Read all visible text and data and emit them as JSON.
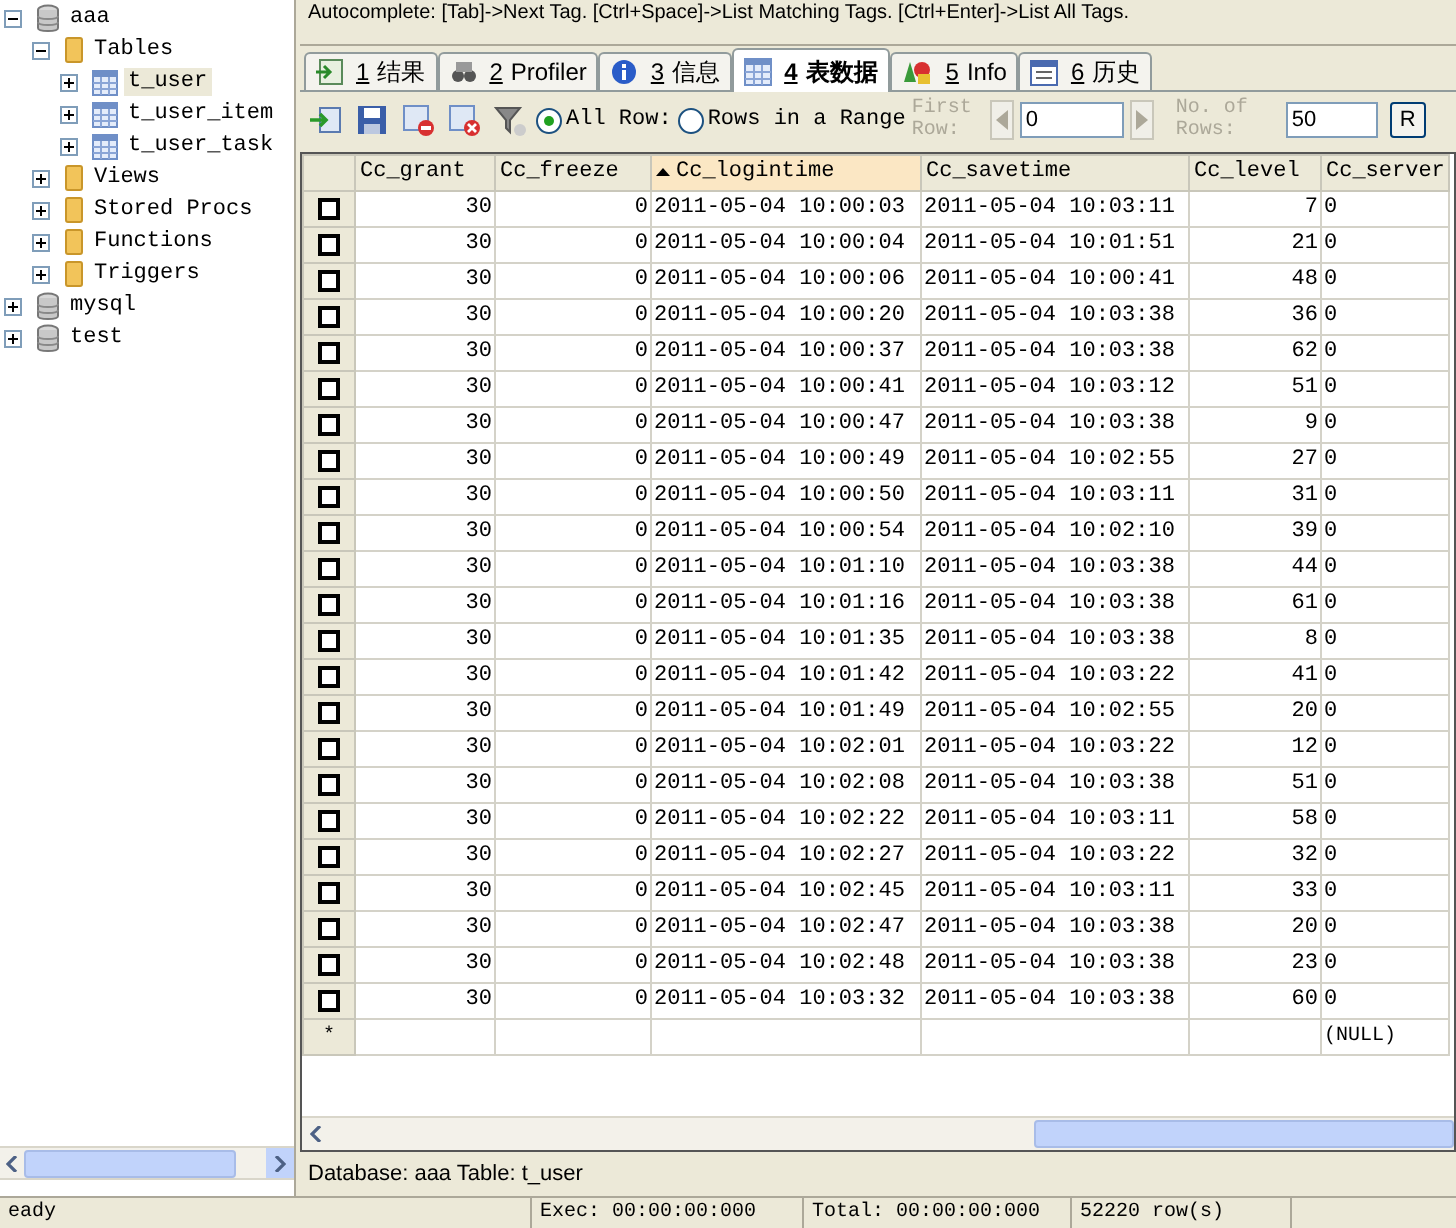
{
  "tree": [
    {
      "label": "aaa",
      "kind": "database",
      "expanded": true,
      "selected": false,
      "children": [
        {
          "label": "Tables",
          "kind": "folder",
          "expanded": true,
          "selected": false,
          "children": [
            {
              "label": "t_user",
              "kind": "table",
              "expanded": false,
              "selected": true
            },
            {
              "label": "t_user_item",
              "kind": "table",
              "expanded": false,
              "selected": false
            },
            {
              "label": "t_user_task",
              "kind": "table",
              "expanded": false,
              "selected": false
            }
          ]
        },
        {
          "label": "Views",
          "kind": "folder",
          "expanded": false,
          "selected": false
        },
        {
          "label": "Stored Procs",
          "kind": "folder",
          "expanded": false,
          "selected": false
        },
        {
          "label": "Functions",
          "kind": "folder",
          "expanded": false,
          "selected": false
        },
        {
          "label": "Triggers",
          "kind": "folder",
          "expanded": false,
          "selected": false
        }
      ]
    },
    {
      "label": "mysql",
      "kind": "database",
      "expanded": false,
      "selected": false
    },
    {
      "label": "test",
      "kind": "database",
      "expanded": false,
      "selected": false
    }
  ],
  "autocomplete_hint": "Autocomplete: [Tab]->Next Tag. [Ctrl+Space]->List Matching Tags. [Ctrl+Enter]->List All Tags.",
  "tabs": [
    {
      "number": "1",
      "label": "结果",
      "kind": "result",
      "selected": false
    },
    {
      "number": "2",
      "label": "Profiler",
      "kind": "profiler",
      "selected": false
    },
    {
      "number": "3",
      "label": "信息",
      "kind": "info",
      "selected": false
    },
    {
      "number": "4",
      "label": "表数据",
      "kind": "table",
      "selected": true
    },
    {
      "number": "5",
      "label": "Info",
      "kind": "shapes",
      "selected": false
    },
    {
      "number": "6",
      "label": "历史",
      "kind": "calendar",
      "selected": false
    }
  ],
  "toolbar": {
    "radios": [
      {
        "label": "All Row:",
        "selected": true
      },
      {
        "label": "Rows in a Range",
        "selected": false
      }
    ],
    "range": {
      "disabled": true,
      "first_row_label": "First Row:",
      "first_row_value": "0",
      "rows_label": "No. of Rows:",
      "rows_value": "50"
    },
    "refresh_button": "R"
  },
  "table": {
    "columns": [
      {
        "label": "Cc_grant",
        "sorted_ascending": false
      },
      {
        "label": "Cc_freeze",
        "sorted_ascending": false
      },
      {
        "label": "Cc_logintime",
        "sorted_ascending": true
      },
      {
        "label": "Cc_savetime",
        "sorted_ascending": false
      },
      {
        "label": "Cc_level",
        "sorted_ascending": false
      },
      {
        "label": "Cc_server",
        "sorted_ascending": false
      }
    ],
    "rows": [
      {
        "checked": false,
        "cells": [
          "30",
          "0",
          "2011-05-04 10:00:03",
          "2011-05-04 10:03:11",
          "7",
          "0"
        ]
      },
      {
        "checked": false,
        "cells": [
          "30",
          "0",
          "2011-05-04 10:00:04",
          "2011-05-04 10:01:51",
          "21",
          "0"
        ]
      },
      {
        "checked": false,
        "cells": [
          "30",
          "0",
          "2011-05-04 10:00:06",
          "2011-05-04 10:00:41",
          "48",
          "0"
        ]
      },
      {
        "checked": false,
        "cells": [
          "30",
          "0",
          "2011-05-04 10:00:20",
          "2011-05-04 10:03:38",
          "36",
          "0"
        ]
      },
      {
        "checked": false,
        "cells": [
          "30",
          "0",
          "2011-05-04 10:00:37",
          "2011-05-04 10:03:38",
          "62",
          "0"
        ]
      },
      {
        "checked": false,
        "cells": [
          "30",
          "0",
          "2011-05-04 10:00:41",
          "2011-05-04 10:03:12",
          "51",
          "0"
        ]
      },
      {
        "checked": false,
        "cells": [
          "30",
          "0",
          "2011-05-04 10:00:47",
          "2011-05-04 10:03:38",
          "9",
          "0"
        ]
      },
      {
        "checked": false,
        "cells": [
          "30",
          "0",
          "2011-05-04 10:00:49",
          "2011-05-04 10:02:55",
          "27",
          "0"
        ]
      },
      {
        "checked": false,
        "cells": [
          "30",
          "0",
          "2011-05-04 10:00:50",
          "2011-05-04 10:03:11",
          "31",
          "0"
        ]
      },
      {
        "checked": false,
        "cells": [
          "30",
          "0",
          "2011-05-04 10:00:54",
          "2011-05-04 10:02:10",
          "39",
          "0"
        ]
      },
      {
        "checked": false,
        "cells": [
          "30",
          "0",
          "2011-05-04 10:01:10",
          "2011-05-04 10:03:38",
          "44",
          "0"
        ]
      },
      {
        "checked": false,
        "cells": [
          "30",
          "0",
          "2011-05-04 10:01:16",
          "2011-05-04 10:03:38",
          "61",
          "0"
        ]
      },
      {
        "checked": false,
        "cells": [
          "30",
          "0",
          "2011-05-04 10:01:35",
          "2011-05-04 10:03:38",
          "8",
          "0"
        ]
      },
      {
        "checked": false,
        "cells": [
          "30",
          "0",
          "2011-05-04 10:01:42",
          "2011-05-04 10:03:22",
          "41",
          "0"
        ]
      },
      {
        "checked": false,
        "cells": [
          "30",
          "0",
          "2011-05-04 10:01:49",
          "2011-05-04 10:02:55",
          "20",
          "0"
        ]
      },
      {
        "checked": false,
        "cells": [
          "30",
          "0",
          "2011-05-04 10:02:01",
          "2011-05-04 10:03:22",
          "12",
          "0"
        ]
      },
      {
        "checked": false,
        "cells": [
          "30",
          "0",
          "2011-05-04 10:02:08",
          "2011-05-04 10:03:38",
          "51",
          "0"
        ]
      },
      {
        "checked": false,
        "cells": [
          "30",
          "0",
          "2011-05-04 10:02:22",
          "2011-05-04 10:03:11",
          "58",
          "0"
        ]
      },
      {
        "checked": false,
        "cells": [
          "30",
          "0",
          "2011-05-04 10:02:27",
          "2011-05-04 10:03:22",
          "32",
          "0"
        ]
      },
      {
        "checked": false,
        "cells": [
          "30",
          "0",
          "2011-05-04 10:02:45",
          "2011-05-04 10:03:11",
          "33",
          "0"
        ]
      },
      {
        "checked": false,
        "cells": [
          "30",
          "0",
          "2011-05-04 10:02:47",
          "2011-05-04 10:03:38",
          "20",
          "0"
        ]
      },
      {
        "checked": false,
        "cells": [
          "30",
          "0",
          "2011-05-04 10:02:48",
          "2011-05-04 10:03:38",
          "23",
          "0"
        ]
      },
      {
        "checked": false,
        "cells": [
          "30",
          "0",
          "2011-05-04 10:03:32",
          "2011-05-04 10:03:38",
          "60",
          "0"
        ]
      }
    ],
    "new_row": {
      "marker": "*",
      "cells": [
        "",
        "",
        "",
        "",
        "",
        "(NULL)"
      ]
    }
  },
  "table_info": "Database: aaa Table: t_user",
  "status_bar": [
    "eady",
    "Exec: 00:00:00:000",
    "Total: 00:00:00:000",
    "52220 row(s)"
  ]
}
